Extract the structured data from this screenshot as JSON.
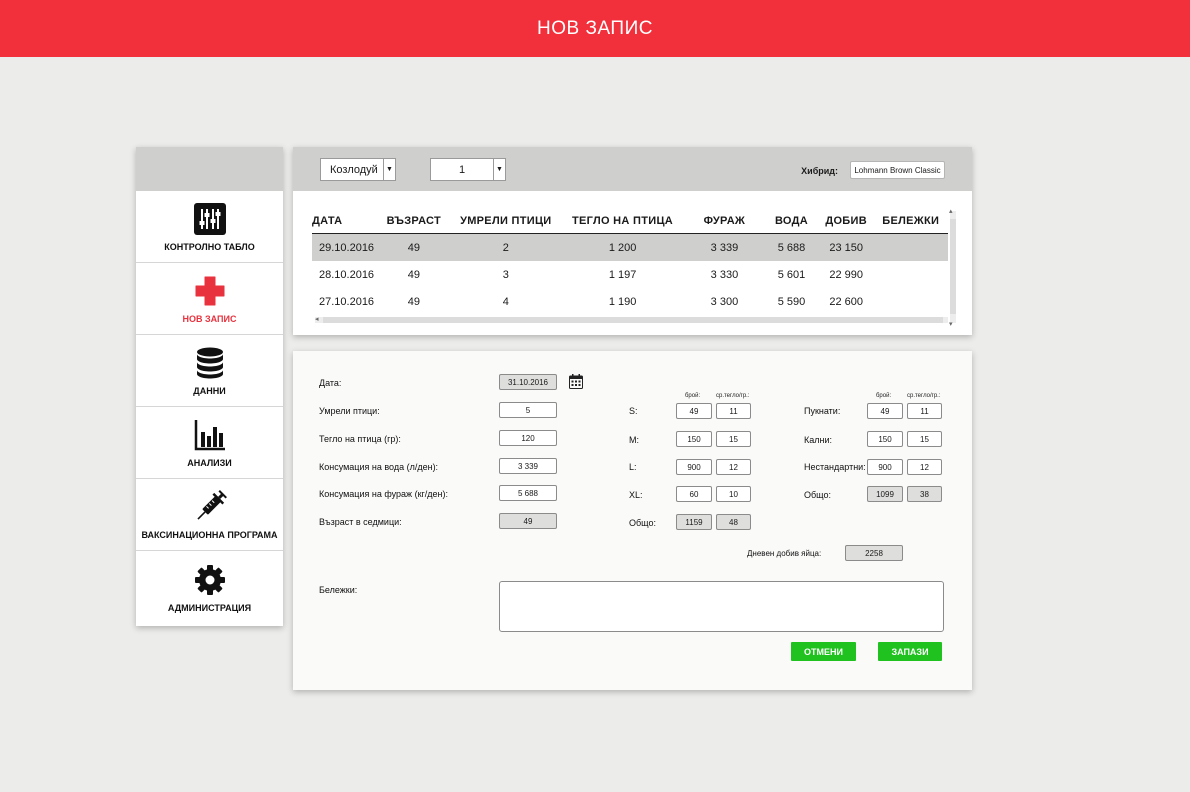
{
  "header": {
    "title": "НОВ ЗАПИС"
  },
  "colors": {
    "accent": "#f2303c",
    "button": "#1fc21f",
    "panel_header": "#cfd0ce"
  },
  "sidebar": {
    "items": [
      {
        "label": "КОНТРОЛНО ТАБЛО",
        "icon": "sliders-icon",
        "active": false
      },
      {
        "label": "НОВ ЗАПИС",
        "icon": "plus-icon",
        "active": true
      },
      {
        "label": "ДАННИ",
        "icon": "database-icon",
        "active": false
      },
      {
        "label": "АНАЛИЗИ",
        "icon": "bar-chart-icon",
        "active": false
      },
      {
        "label": "ВАКСИНАЦИОННА ПРОГРАМА",
        "icon": "syringe-icon",
        "active": false
      },
      {
        "label": "АДМИНИСТРАЦИЯ",
        "icon": "gear-icon",
        "active": false
      }
    ]
  },
  "filters": {
    "farm": "Козлодуй",
    "house": "1",
    "hybrid_label": "Хибрид:",
    "hybrid_value": "Lohmann Brown Classic"
  },
  "table": {
    "columns": [
      "ДАТА",
      "ВЪЗРАСТ",
      "УМРЕЛИ ПТИЦИ",
      "ТЕГЛО НА ПТИЦА",
      "ФУРАЖ",
      "ВОДА",
      "ДОБИВ",
      "БЕЛЕЖКИ"
    ],
    "rows": [
      [
        "29.10.2016",
        "49",
        "2",
        "1 200",
        "3 339",
        "5 688",
        "23 150",
        ""
      ],
      [
        "28.10.2016",
        "49",
        "3",
        "1 197",
        "3 330",
        "5 601",
        "22 990",
        ""
      ],
      [
        "27.10.2016",
        "49",
        "4",
        "1 190",
        "3 300",
        "5 590",
        "22 600",
        ""
      ]
    ],
    "selected_row": 0
  },
  "form": {
    "date_label": "Дата:",
    "date_value": "31.10.2016",
    "dead_label": "Умрели птици:",
    "dead_value": "5",
    "weight_label": "Тегло на птица (гр):",
    "weight_value": "120",
    "water_label": "Консумация на вода (л/ден):",
    "water_value": "3 339",
    "feed_label": "Консумация на фураж (кг/ден):",
    "feed_value": "5 688",
    "age_label": "Възраст в седмици:",
    "age_value": "49",
    "count_header": "брой:",
    "avg_header": "ср.тегло/гр.:",
    "sizes": [
      {
        "label": "S:",
        "count": "49",
        "avg": "11"
      },
      {
        "label": "M:",
        "count": "150",
        "avg": "15"
      },
      {
        "label": "L:",
        "count": "900",
        "avg": "12"
      },
      {
        "label": "XL:",
        "count": "60",
        "avg": "10"
      }
    ],
    "sizes_total": {
      "label": "Общо:",
      "count": "1159",
      "avg": "48"
    },
    "defects": [
      {
        "label": "Пукнати:",
        "count": "49",
        "avg": "11"
      },
      {
        "label": "Кални:",
        "count": "150",
        "avg": "15"
      },
      {
        "label": "Нестандартни:",
        "count": "900",
        "avg": "12"
      }
    ],
    "defects_total": {
      "label": "Общо:",
      "count": "1099",
      "avg": "38"
    },
    "daily_label": "Дневен добив яйца:",
    "daily_value": "2258",
    "notes_label": "Бележки:",
    "notes_value": "",
    "cancel_label": "ОТМЕНИ",
    "save_label": "ЗАПАЗИ"
  }
}
